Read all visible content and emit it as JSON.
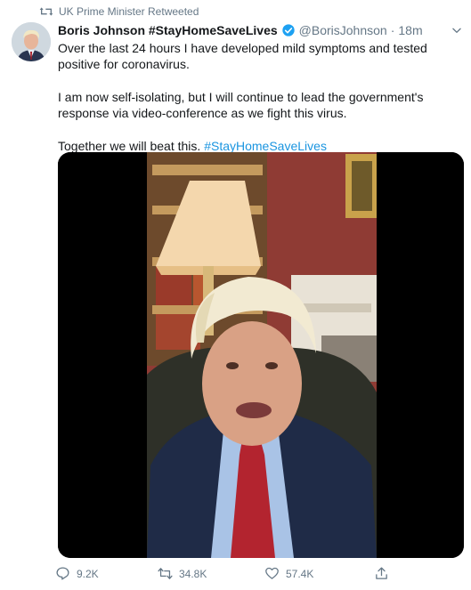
{
  "retweet_context": {
    "icon": "retweet-icon",
    "label": "UK Prime Minister Retweeted"
  },
  "author": {
    "avatar": "avatar",
    "display_name": "Boris Johnson #StayHomeSaveLives",
    "verified_icon": "verified-badge-icon",
    "handle": "@BorisJohnson",
    "separator": "·",
    "timestamp": "18m"
  },
  "tweet": {
    "paragraph_1": "Over the last 24 hours I have developed mild symptoms and tested positive for coronavirus.",
    "paragraph_2": "I am now self-isolating, but I will continue to lead the government's response via video-conference as we fight this virus.",
    "paragraph_3_text": "Together we will beat this.",
    "paragraph_3_hashtag": "#StayHomeSaveLives"
  },
  "media": {
    "type": "video"
  },
  "actions": {
    "reply_count": "9.2K",
    "retweet_count": "34.8K",
    "like_count": "57.4K"
  },
  "colors": {
    "link": "#1b95e0",
    "secondary_text": "#657786",
    "primary_text": "#14171a",
    "verified": "#1da1f2"
  }
}
